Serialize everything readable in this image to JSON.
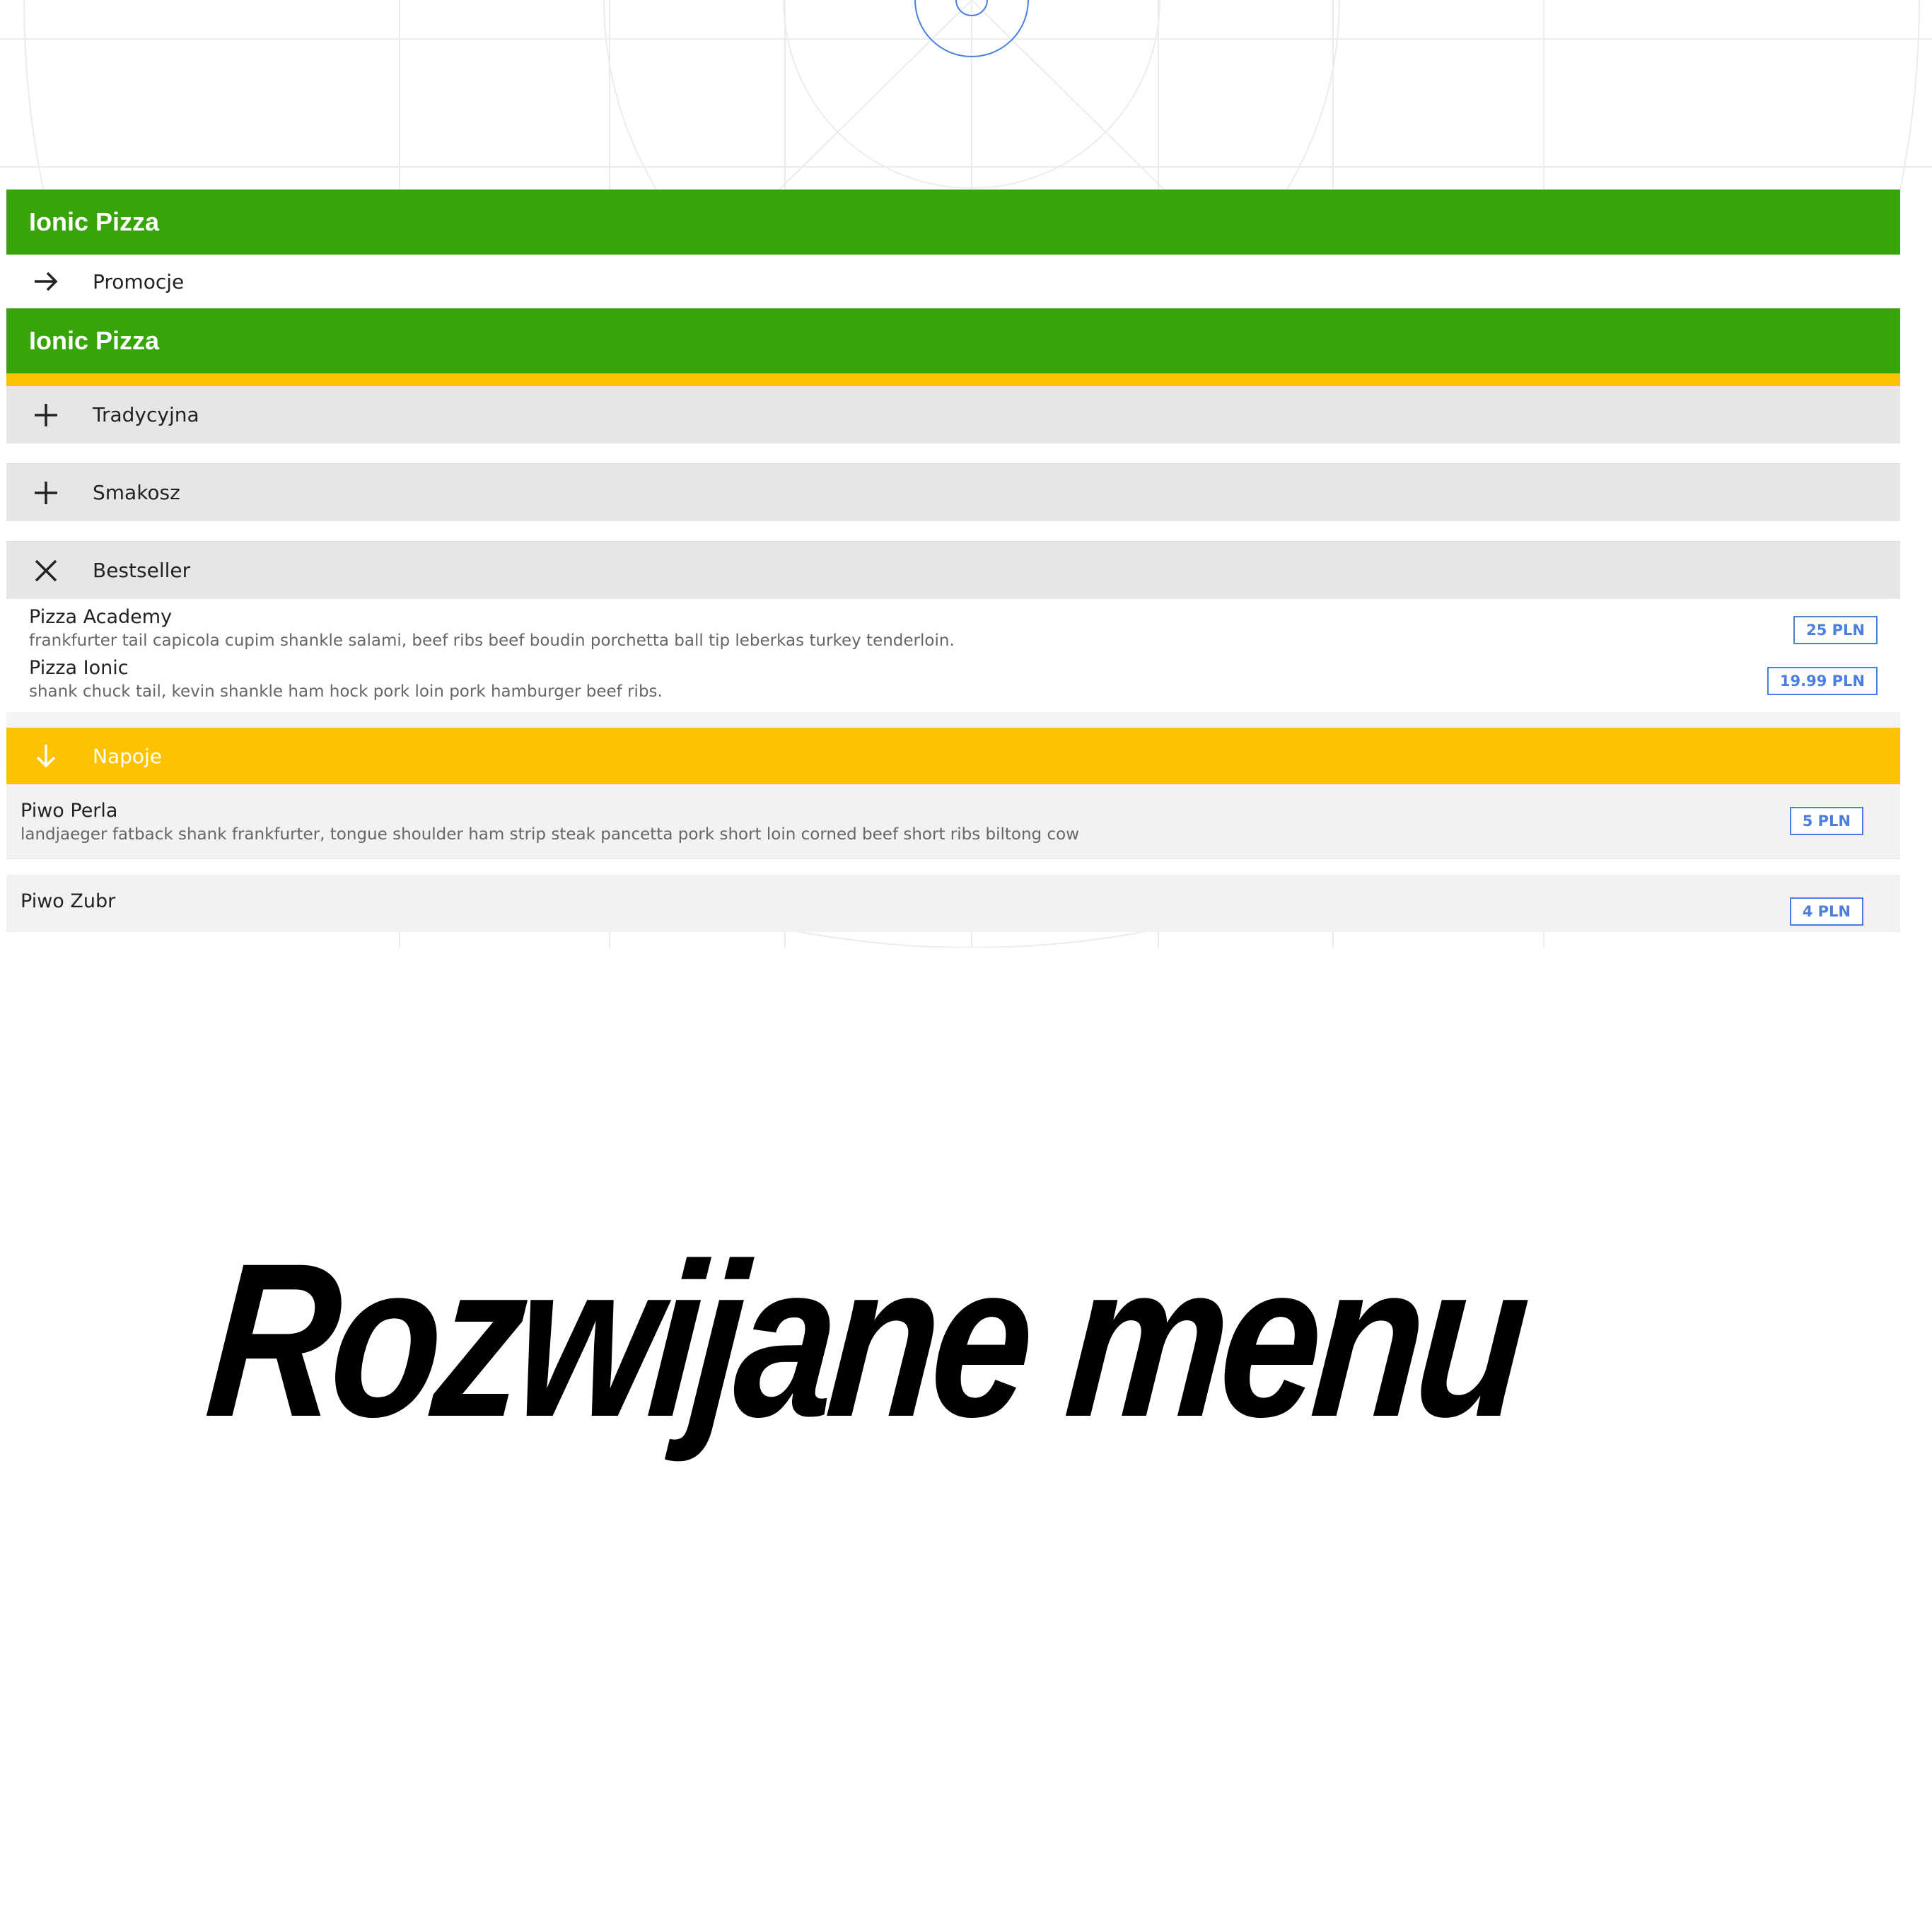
{
  "app": {
    "title": "Ionic Pizza"
  },
  "menu": {
    "promotions_label": "Promocje"
  },
  "groups": [
    {
      "label": "Tradycyjna",
      "icon": "plus-icon"
    },
    {
      "label": "Smakosz",
      "icon": "plus-icon"
    },
    {
      "label": "Bestseller",
      "icon": "close-icon"
    }
  ],
  "bestseller_items": [
    {
      "name": "Pizza Academy",
      "description": "frankfurter tail capicola cupim shankle salami, beef ribs beef boudin porchetta ball tip leberkas turkey tenderloin.",
      "price": "25 PLN"
    },
    {
      "name": "Pizza Ionic",
      "description": "shank chuck tail, kevin shankle ham hock pork loin pork hamburger beef ribs.",
      "price": "19.99 PLN"
    }
  ],
  "drinks_group": {
    "label": "Napoje",
    "icon": "arrow-down-icon"
  },
  "drinks": [
    {
      "name": "Piwo Perla",
      "description": "landjaeger fatback shank frankfurter, tongue shoulder ham strip steak pancetta pork short loin corned beef short ribs biltong cow",
      "price": "5 PLN"
    },
    {
      "name": "Piwo Zubr",
      "description": "",
      "price": "4 PLN"
    }
  ],
  "caption": "Rozwijane menu",
  "colors": {
    "toolbar": "#37a40a",
    "accent": "#fdc202",
    "price": "#4a7fe0",
    "group_bg": "#e7e6e4"
  }
}
